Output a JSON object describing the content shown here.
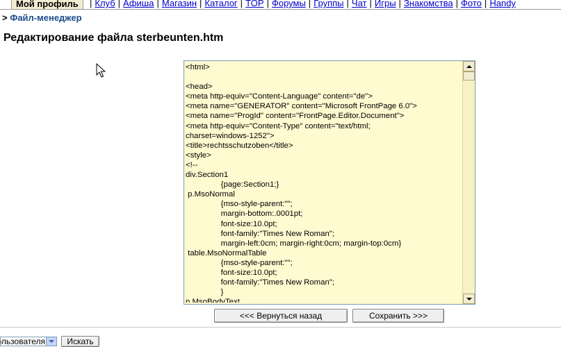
{
  "nav": {
    "active_tab": "Мой профиль",
    "links": [
      "Клуб",
      "Афиша",
      "Магазин",
      "Каталог",
      "TOP",
      "Форумы",
      "Группы",
      "Чат",
      "Игры",
      "Знакомства",
      "Фото",
      "Handy"
    ]
  },
  "breadcrumb": {
    "prefix": ">",
    "link": "Файл-менеджер"
  },
  "page_title": "Редактирование файла sterbeunten.htm",
  "editor": {
    "content": "<html>\n\n<head>\n<meta http-equiv=\"Content-Language\" content=\"de\">\n<meta name=\"GENERATOR\" content=\"Microsoft FrontPage 6.0\">\n<meta name=\"ProgId\" content=\"FrontPage.Editor.Document\">\n<meta http-equiv=\"Content-Type\" content=\"text/html;\ncharset=windows-1252\">\n<title>rechtsschutzoben</title>\n<style>\n<!--\ndiv.Section1\n\t\t{page:Section1;}\n p.MsoNormal\n\t\t{mso-style-parent:\"\";\n\t\tmargin-bottom:.0001pt;\n\t\tfont-size:10.0pt;\n\t\tfont-family:\"Times New Roman\";\n\t\tmargin-left:0cm; margin-right:0cm; margin-top:0cm}\n table.MsoNormalTable\n\t\t{mso-style-parent:\"\";\n\t\tfont-size:10.0pt;\n\t\tfont-family:\"Times New Roman\";\n\t\t}\np.MsoBodyText"
  },
  "buttons": {
    "back": "<<< Вернуться назад",
    "save": "Сохранить >>>"
  },
  "bottom": {
    "select_value": "пользователя",
    "search_button": "Искать"
  },
  "colors": {
    "editor_bg": "#fffad0",
    "link": "#0000cc",
    "tab_bg": "#f2ecd0"
  }
}
